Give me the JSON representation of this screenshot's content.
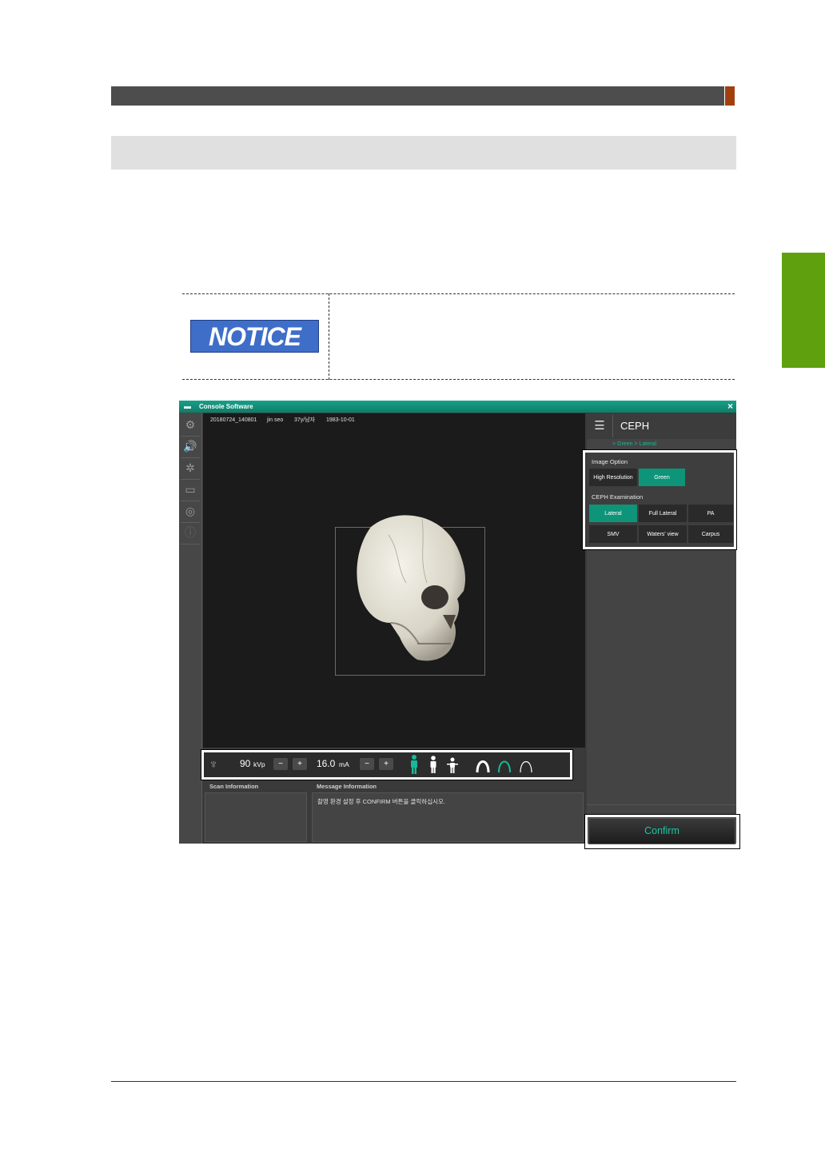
{
  "notice": {
    "badge": "NOTICE"
  },
  "app": {
    "title": "Console Software",
    "close": "×",
    "toolbar": {
      "settings_icon": "⚙",
      "sound_icon": "🔊",
      "laser_icon": "✲",
      "monitor_icon": "▭",
      "target_icon": "◎",
      "info_icon": "ⓘ"
    },
    "patient": {
      "id": "20180724_140801",
      "name": "jin seo",
      "age_sex": "37y/남자",
      "birth": "1983-10-01"
    },
    "exposure": {
      "kvp_value": "90",
      "kvp_unit": "kVp",
      "ma_value": "16.0",
      "ma_unit": "mA",
      "minus": "−",
      "plus": "+"
    },
    "scan_info_label": "Scan Information",
    "message_info_label": "Message Information",
    "message_text": "촬영 환경 설정 후 CONFIRM 버튼을 클릭하십시오.",
    "panel": {
      "title": "CEPH",
      "breadcrumb": "> Green > Lateral",
      "image_option_label": "Image Option",
      "image_options": [
        {
          "label": "High Resolution",
          "active": false
        },
        {
          "label": "Green",
          "active": true
        }
      ],
      "ceph_exam_label": "CEPH Examination",
      "ceph_exams": [
        {
          "label": "Lateral",
          "active": true
        },
        {
          "label": "Full Lateral",
          "active": false
        },
        {
          "label": "PA",
          "active": false
        },
        {
          "label": "SMV",
          "active": false
        },
        {
          "label": "Waters' view",
          "active": false
        },
        {
          "label": "Carpus",
          "active": false
        }
      ]
    },
    "confirm": "Confirm"
  },
  "colors": {
    "accent": "#0e9478",
    "titlebar": "#16a088",
    "side_tab": "#5fa00e",
    "notice_badge": "#3e6ec8",
    "header_accent": "#a0400e"
  }
}
